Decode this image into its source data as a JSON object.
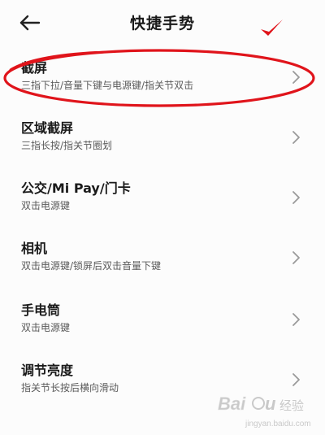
{
  "header": {
    "title": "快捷手势",
    "back_icon": "arrow-left-icon"
  },
  "items": [
    {
      "title": "截屏",
      "subtitle": "三指下拉/音量下键与电源键/指关节双击"
    },
    {
      "title": "区域截屏",
      "subtitle": "三指长按/指关节圈划"
    },
    {
      "title": "公交/Mi Pay/门卡",
      "subtitle": "双击电源键"
    },
    {
      "title": "相机",
      "subtitle": "双击电源键/锁屏后双击音量下键"
    },
    {
      "title": "手电筒",
      "subtitle": "双击电源键"
    },
    {
      "title": "调节亮度",
      "subtitle": "指关节长按后横向滑动"
    }
  ],
  "annotation": {
    "color": "#e0141b"
  },
  "watermark": {
    "text": "Baidu 经验",
    "url": "jingyan.baidu.com"
  }
}
